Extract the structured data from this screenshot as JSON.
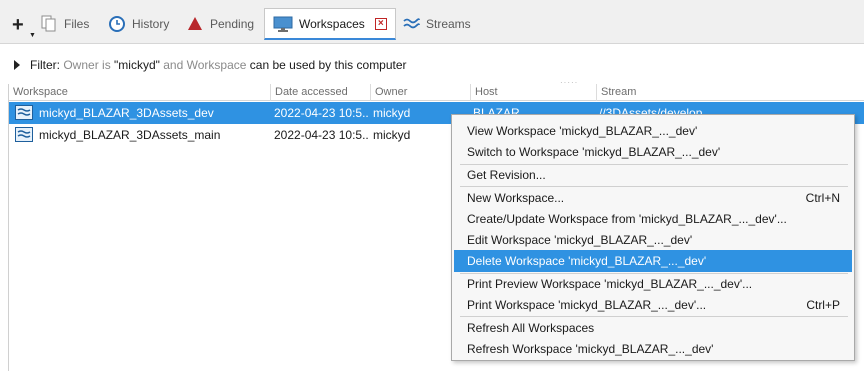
{
  "tabs": {
    "files": "Files",
    "history": "History",
    "pending": "Pending",
    "workspaces": "Workspaces",
    "streams": "Streams"
  },
  "filter": {
    "prefix": "Filter:",
    "owner_field": "Owner",
    "is_word": "is",
    "owner_value": "\"mickyd\"",
    "and_word": "and",
    "workspace_field": "Workspace",
    "condition": "can be used by this computer"
  },
  "table": {
    "columns": [
      "Workspace",
      "Date accessed",
      "Owner",
      "Host",
      "Stream"
    ],
    "rows": [
      {
        "workspace": "mickyd_BLAZAR_3DAssets_dev",
        "date": "2022-04-23 10:5...",
        "owner": "mickyd",
        "host": "BLAZAR",
        "stream": "//3DAssets/develop",
        "selected": true
      },
      {
        "workspace": "mickyd_BLAZAR_3DAssets_main",
        "date": "2022-04-23 10:5...",
        "owner": "mickyd",
        "host": "",
        "stream": "",
        "selected": false
      }
    ]
  },
  "context_menu": {
    "items": [
      {
        "label": "View Workspace 'mickyd_BLAZAR_..._dev'",
        "shortcut": ""
      },
      {
        "label": "Switch to Workspace 'mickyd_BLAZAR_..._dev'",
        "shortcut": ""
      },
      {
        "label": "Get Revision...",
        "shortcut": ""
      },
      {
        "label": "New Workspace...",
        "shortcut": "Ctrl+N"
      },
      {
        "label": "Create/Update Workspace from 'mickyd_BLAZAR_..._dev'...",
        "shortcut": ""
      },
      {
        "label": "Edit Workspace 'mickyd_BLAZAR_..._dev'",
        "shortcut": ""
      },
      {
        "label": "Delete Workspace 'mickyd_BLAZAR_..._dev'",
        "shortcut": "",
        "highlighted": true
      },
      {
        "label": "Print Preview Workspace 'mickyd_BLAZAR_..._dev'...",
        "shortcut": ""
      },
      {
        "label": "Print Workspace 'mickyd_BLAZAR_..._dev'...",
        "shortcut": "Ctrl+P"
      },
      {
        "label": "Refresh All Workspaces",
        "shortcut": ""
      },
      {
        "label": "Refresh Workspace 'mickyd_BLAZAR_..._dev'",
        "shortcut": ""
      }
    ]
  },
  "icons": {
    "add": "plus-icon",
    "files": "files-icon",
    "history": "clock-icon",
    "pending": "triangle-icon",
    "workspaces": "monitor-icon",
    "close": "close-icon",
    "streams": "streams-icon",
    "workspace_row": "workspace-icon"
  },
  "colors": {
    "accent": "#2f92e2",
    "selection": "#2f92e2",
    "pending_red": "#b8272b",
    "close_red": "#c02424"
  }
}
